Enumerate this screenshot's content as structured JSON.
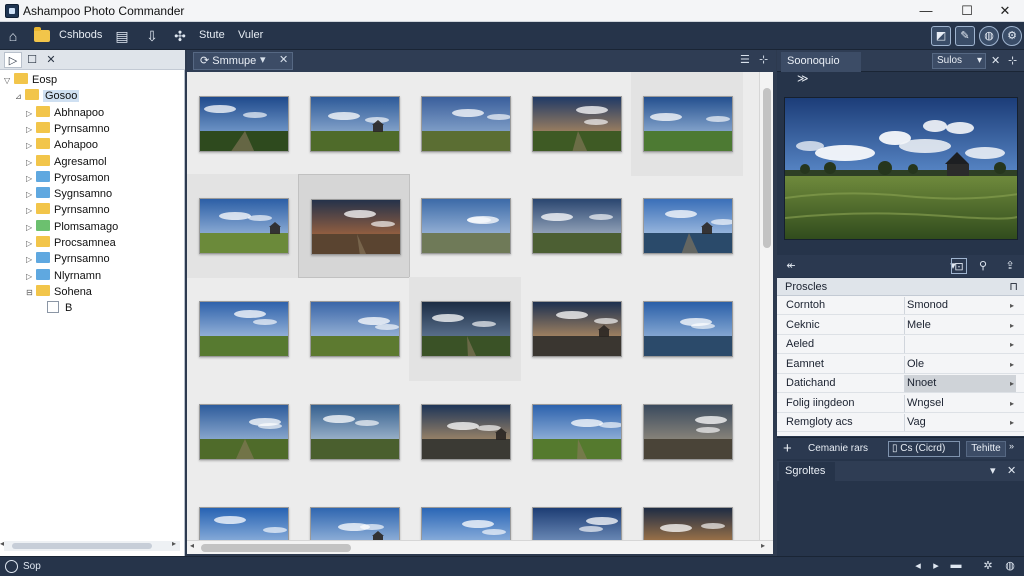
{
  "window": {
    "title": "Ashampoo Photo Commander",
    "minimize": "—",
    "maximize": "☐",
    "close": "✕"
  },
  "toolbar": {
    "items": [
      {
        "label": "Cshbods"
      },
      {
        "label": ""
      },
      {
        "label": ""
      },
      {
        "label": "Stute"
      },
      {
        "label": "Vuler"
      }
    ]
  },
  "left_panel": {
    "tabs": [
      "▷",
      "☐",
      "✕"
    ],
    "tree": [
      {
        "label": "Eosp",
        "indent": 0,
        "arrow": "▽",
        "color": "yellow"
      },
      {
        "label": "Gosoo",
        "indent": 1,
        "arrow": "⊿",
        "color": "yellow",
        "selected": true
      },
      {
        "label": "Abhnapoo",
        "indent": 2,
        "arrow": "▷",
        "color": "yellow"
      },
      {
        "label": "Pyrnsamno",
        "indent": 2,
        "arrow": "▷",
        "color": "yellow"
      },
      {
        "label": "Aohapoo",
        "indent": 2,
        "arrow": "▷",
        "color": "yellow"
      },
      {
        "label": "Agresamol",
        "indent": 2,
        "arrow": "▷",
        "color": "yellow"
      },
      {
        "label": "Pyrosamon",
        "indent": 2,
        "arrow": "▷",
        "color": "blue"
      },
      {
        "label": "Sygnsamno",
        "indent": 2,
        "arrow": "▷",
        "color": "blue"
      },
      {
        "label": "Pyrnsamno",
        "indent": 2,
        "arrow": "▷",
        "color": "yellow"
      },
      {
        "label": "Plomsamago",
        "indent": 2,
        "arrow": "▷",
        "color": "green"
      },
      {
        "label": "Procsamnea",
        "indent": 2,
        "arrow": "▷",
        "color": "yellow"
      },
      {
        "label": "Pyrnsamno",
        "indent": 2,
        "arrow": "▷",
        "color": "blue"
      },
      {
        "label": "Nlyrnamn",
        "indent": 2,
        "arrow": "▷",
        "color": "blue"
      },
      {
        "label": "Sohena",
        "indent": 2,
        "arrow": "⊟",
        "color": "yellow"
      },
      {
        "label": "B",
        "indent": 3,
        "arrow": "",
        "color": "file"
      }
    ]
  },
  "center": {
    "tab_label": "Smmupe",
    "tab_dropdown": "▾",
    "tab_close": "✕",
    "menu_icon": "☰",
    "pin_icon": "⊹"
  },
  "thumbnails": [
    {
      "scene": "lake-clouds"
    },
    {
      "scene": "barn-field"
    },
    {
      "scene": "road-field"
    },
    {
      "scene": "sunset-path"
    },
    {
      "scene": "river-trees"
    },
    {
      "scene": "country-road"
    },
    {
      "scene": "red-house"
    },
    {
      "scene": "stone-cottage"
    },
    {
      "scene": "dirt-track"
    },
    {
      "scene": "calm-lake"
    },
    {
      "scene": "meadow-clouds"
    },
    {
      "scene": "barn-meadow"
    },
    {
      "scene": "dark-hills"
    },
    {
      "scene": "rock-sunset"
    },
    {
      "scene": "mirror-lake"
    },
    {
      "scene": "barn-storm"
    },
    {
      "scene": "forest-road"
    },
    {
      "scene": "horizon-road"
    },
    {
      "scene": "valley-road"
    },
    {
      "scene": "pier-dusk"
    },
    {
      "scene": "blue-sky"
    },
    {
      "scene": "cloudy-field"
    },
    {
      "scene": "green-hill"
    },
    {
      "scene": "swirl-sky"
    },
    {
      "scene": "golden-dusk"
    }
  ],
  "right_panel": {
    "preview_tab": "Soonoquio",
    "preview_tab_arrow": "≫",
    "preview_dropdown": "Sulos",
    "preview_dropdown_arrow": "▾",
    "preview_close": "✕",
    "preview_pin": "⊹",
    "properties_title": "Proscles",
    "properties_pin_icon": "⊓",
    "properties": [
      {
        "name": "Corntoh",
        "value": "Smonod"
      },
      {
        "name": "Ceknic",
        "value": "Mele"
      },
      {
        "name": "Aeled",
        "value": ""
      },
      {
        "name": "Eamnet",
        "value": "Ole"
      },
      {
        "name": "Datichand",
        "value": "Nnoet",
        "active": true
      },
      {
        "name": "Folig iingdeon",
        "value": "Wngsel"
      },
      {
        "name": "Remgloty acs",
        "value": "Vag"
      }
    ],
    "footer_add": "+",
    "footer_label": "Cemanie rars",
    "footer_field": "▯ Cs (Cicrd)",
    "footer_button": "Tehitte",
    "footer_more": "»",
    "scripts_title": "Sgroltes",
    "scripts_dropdown": "▾",
    "scripts_close": "✕"
  },
  "statusbar": {
    "text": "Sop"
  }
}
